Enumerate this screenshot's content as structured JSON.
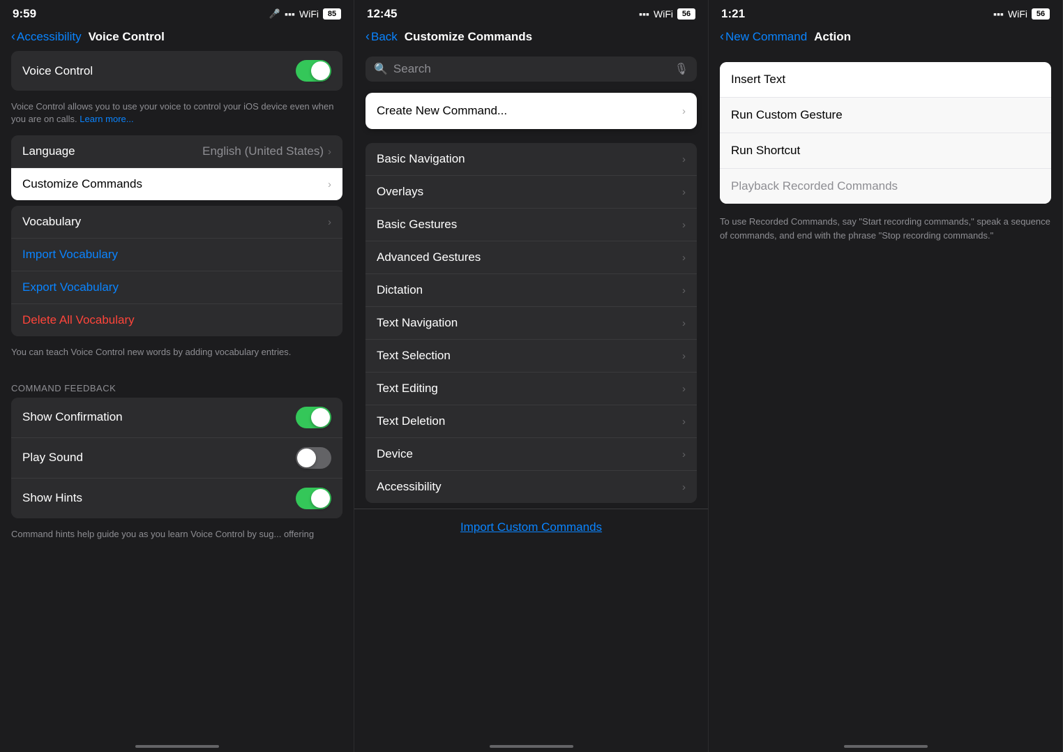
{
  "panel1": {
    "status": {
      "time": "9:59",
      "mic": "🎤",
      "wifi": "WiFi",
      "battery": "85"
    },
    "nav": {
      "back_label": "Accessibility",
      "title": "Voice Control"
    },
    "voice_control_label": "Voice Control",
    "voice_control_toggle": "on",
    "description": "Voice Control allows you to use your voice to control your iOS device even when you are on calls. Learn more...",
    "language_label": "Language",
    "language_value": "English (United States)",
    "customize_label": "Customize Commands",
    "vocabulary_label": "Vocabulary",
    "import_vocab_label": "Import Vocabulary",
    "export_vocab_label": "Export Vocabulary",
    "delete_vocab_label": "Delete All Vocabulary",
    "vocab_desc": "You can teach Voice Control new words by adding vocabulary entries.",
    "command_feedback_header": "COMMAND FEEDBACK",
    "show_confirmation_label": "Show Confirmation",
    "show_confirmation_toggle": "on",
    "play_sound_label": "Play Sound",
    "play_sound_toggle": "off",
    "show_hints_label": "Show Hints",
    "show_hints_toggle": "on",
    "hints_desc": "Command hints help guide you as you learn Voice Control by sug... offering"
  },
  "panel2": {
    "status": {
      "time": "12:45",
      "wifi": "WiFi",
      "battery": "56"
    },
    "nav": {
      "back_label": "Back",
      "title": "Customize Commands"
    },
    "search_placeholder": "Search",
    "create_btn_label": "Create New Command...",
    "items": [
      {
        "label": "Basic Navigation"
      },
      {
        "label": "Overlays"
      },
      {
        "label": "Basic Gestures"
      },
      {
        "label": "Advanced Gestures"
      },
      {
        "label": "Dictation"
      },
      {
        "label": "Text Navigation"
      },
      {
        "label": "Text Selection"
      },
      {
        "label": "Text Editing"
      },
      {
        "label": "Text Deletion"
      },
      {
        "label": "Device"
      },
      {
        "label": "Accessibility"
      }
    ],
    "import_label": "Import Custom Commands"
  },
  "panel3": {
    "status": {
      "time": "1:21",
      "wifi": "WiFi",
      "battery": "56"
    },
    "nav": {
      "back_label": "New Command",
      "title": "Action"
    },
    "actions": [
      {
        "label": "Insert Text",
        "muted": false
      },
      {
        "label": "Run Custom Gesture",
        "muted": false
      },
      {
        "label": "Run Shortcut",
        "muted": false
      },
      {
        "label": "Playback Recorded Commands",
        "muted": true
      }
    ],
    "playback_desc": "To use Recorded Commands, say \"Start recording commands,\" speak a sequence of commands, and end with the phrase \"Stop recording commands.\""
  }
}
